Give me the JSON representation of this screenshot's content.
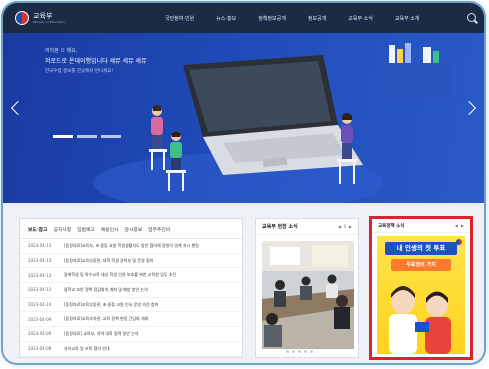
{
  "header": {
    "logo_name": "교육부",
    "logo_sub": "Ministry of Education",
    "nav": [
      "국민참여·민원",
      "뉴스·홍보",
      "정책정보공개",
      "정보공개",
      "교육부 소식",
      "교육부 소개"
    ]
  },
  "hero": {
    "line1": "여러분 ㅁ 해요,",
    "line2": "저로드로 온데이행입니다 세뮤 세뮤 세뮤",
    "line3": "한국수업 정보를 한곳에서 만나세요!"
  },
  "news": {
    "tabs": [
      "보도·참고",
      "공지사항",
      "입법예고",
      "채용인사",
      "감사정보",
      "업무추진비"
    ],
    "rows": [
      {
        "date": "2023-04-13",
        "title": "[동정자료]교육부, 초·중등 교원 학생생활지도 방안 협의체 정원의 경계 지시 행정"
      },
      {
        "date": "2023-04-13",
        "title": "[동정자료]교육부장관, 대학 학생 경력부 및 운영 협의"
      },
      {
        "date": "2023-04-13",
        "title": "장애학생 및 특수교육 대상 학생 인권 보호를 위한 교육청 업무 추진"
      },
      {
        "date": "2023-04-12",
        "title": "중학교 보안 정책 점검회의 개최 및 예방 방안 논의"
      },
      {
        "date": "2023-04-10",
        "title": "[동정자료]교육부장관, 초·중등 교원 인사 운영 의견 청취"
      },
      {
        "date": "2023-04-09",
        "title": "[동정자료]교육부차관, 교육 정책 현장 간담회 개최"
      },
      {
        "date": "2023-04-09",
        "title": "[동정자료] 교육부, 지역 대학 협력 방안 논의"
      },
      {
        "date": "2023-04-08",
        "title": "유아교육 및 보육 협의 안내"
      }
    ]
  },
  "photo": {
    "title": "교육부 현장 소식",
    "prev": "◀",
    "pause": "Ⅱ",
    "next": "▶"
  },
  "policy": {
    "title": "교육정책 소식",
    "line1": "내 인생의 첫 투표",
    "line2": "투표권의 가치"
  },
  "colors": {
    "topbar": "#1b2a45",
    "hero_blue": "#1f4bb8",
    "highlight_red": "#d8252c",
    "policy_yellow": "#ffd21f"
  }
}
